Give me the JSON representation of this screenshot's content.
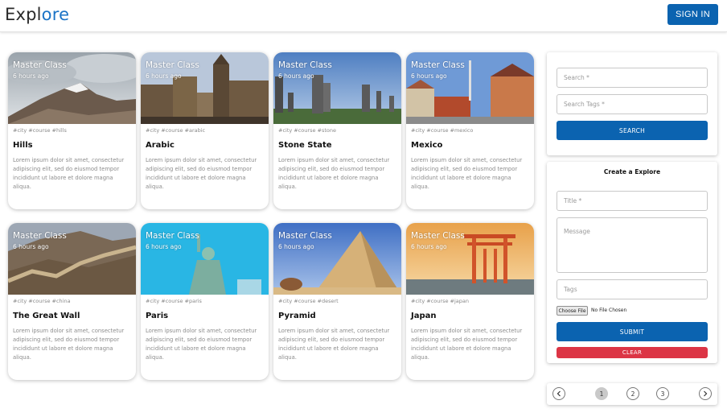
{
  "header": {
    "logo_part1": "Expl",
    "logo_part2": "ore",
    "signin_label": "SIGN IN"
  },
  "posts": [
    {
      "creator": "Master Class",
      "time": "6 hours ago",
      "tags": "#city #course #hills",
      "title": "Hills",
      "message": "Lorem ipsum dolor sit amet, consectetur adipiscing elit, sed do eiusmod tempor incididunt ut labore et dolore magna aliqua."
    },
    {
      "creator": "Master Class",
      "time": "6 hours ago",
      "tags": "#city #course #arabic",
      "title": "Arabic",
      "message": "Lorem ipsum dolor sit amet, consectetur adipiscing elit, sed do eiusmod tempor incididunt ut labore et dolore magna aliqua."
    },
    {
      "creator": "Master Class",
      "time": "6 hours ago",
      "tags": "#city #course #stone",
      "title": "Stone State",
      "message": "Lorem ipsum dolor sit amet, consectetur adipiscing elit, sed do eiusmod tempor incididunt ut labore et dolore magna aliqua."
    },
    {
      "creator": "Master Class",
      "time": "6 hours ago",
      "tags": "#city #course #mexico",
      "title": "Mexico",
      "message": "Lorem ipsum dolor sit amet, consectetur adipiscing elit, sed do eiusmod tempor incididunt ut labore et dolore magna aliqua."
    },
    {
      "creator": "Master Class",
      "time": "6 hours ago",
      "tags": "#city #course #china",
      "title": "The Great Wall",
      "message": "Lorem ipsum dolor sit amet, consectetur adipiscing elit, sed do eiusmod tempor incididunt ut labore et dolore magna aliqua."
    },
    {
      "creator": "Master Class",
      "time": "6 hours ago",
      "tags": "#city #course #paris",
      "title": "Paris",
      "message": "Lorem ipsum dolor sit amet, consectetur adipiscing elit, sed do eiusmod tempor incididunt ut labore et dolore magna aliqua."
    },
    {
      "creator": "Master Class",
      "time": "6 hours ago",
      "tags": "#city #course #desert",
      "title": "Pyramid",
      "message": "Lorem ipsum dolor sit amet, consectetur adipiscing elit, sed do eiusmod tempor incididunt ut labore et dolore magna aliqua."
    },
    {
      "creator": "Master Class",
      "time": "6 hours ago",
      "tags": "#city #course #japan",
      "title": "Japan",
      "message": "Lorem ipsum dolor sit amet, consectetur adipiscing elit, sed do eiusmod tempor incididunt ut labore et dolore magna aliqua."
    }
  ],
  "search": {
    "search_placeholder": "Search *",
    "tags_placeholder": "Search Tags *",
    "button_label": "SEARCH"
  },
  "form": {
    "title": "Create a Explore",
    "title_placeholder": "Title *",
    "message_placeholder": "Message",
    "tags_placeholder": "Tags",
    "file_button_label": "Choose File",
    "file_status": "No File Chosen",
    "submit_label": "SUBMIT",
    "clear_label": "CLEAR"
  },
  "pagination": {
    "prev_icon": "chevron-left-icon",
    "next_icon": "chevron-right-icon",
    "pages": [
      "1",
      "2",
      "3"
    ],
    "current_page": "1"
  },
  "colors": {
    "primary": "#0b63b0",
    "danger": "#dc3545",
    "logo_accent": "#1b73c6"
  }
}
